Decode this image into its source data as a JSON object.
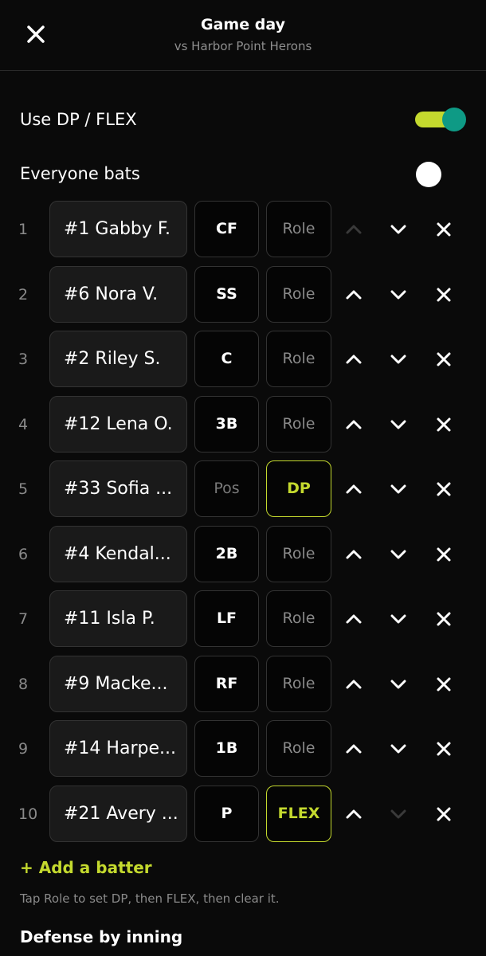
{
  "header": {
    "title": "Game day",
    "subtitle": "vs Harbor Point Herons",
    "close_icon": "close-icon"
  },
  "settings": {
    "dp_flex": {
      "label": "Use DP / FLEX",
      "enabled": true
    },
    "everyone_bats": {
      "label": "Everyone bats",
      "enabled": false
    }
  },
  "lineup": [
    {
      "order": "1",
      "player": "#1 Gabby F.",
      "position": "CF",
      "role": "Role",
      "up_enabled": false,
      "down_enabled": true
    },
    {
      "order": "2",
      "player": "#6 Nora V.",
      "position": "SS",
      "role": "Role",
      "up_enabled": true,
      "down_enabled": true
    },
    {
      "order": "3",
      "player": "#2 Riley S.",
      "position": "C",
      "role": "Role",
      "up_enabled": true,
      "down_enabled": true
    },
    {
      "order": "4",
      "player": "#12 Lena O.",
      "position": "3B",
      "role": "Role",
      "up_enabled": true,
      "down_enabled": true
    },
    {
      "order": "5",
      "player": "#33 Sofia ...",
      "position": "Pos",
      "role": "DP",
      "up_enabled": true,
      "down_enabled": true
    },
    {
      "order": "6",
      "player": "#4 Kendal...",
      "position": "2B",
      "role": "Role",
      "up_enabled": true,
      "down_enabled": true
    },
    {
      "order": "7",
      "player": "#11 Isla P.",
      "position": "LF",
      "role": "Role",
      "up_enabled": true,
      "down_enabled": true
    },
    {
      "order": "8",
      "player": "#9 Macke...",
      "position": "RF",
      "role": "Role",
      "up_enabled": true,
      "down_enabled": true
    },
    {
      "order": "9",
      "player": "#14 Harpe...",
      "position": "1B",
      "role": "Role",
      "up_enabled": true,
      "down_enabled": true
    },
    {
      "order": "10",
      "player": "#21 Avery ...",
      "position": "P",
      "role": "FLEX",
      "up_enabled": true,
      "down_enabled": false
    }
  ],
  "add_batter_label": "+ Add a batter",
  "hint": "Tap Role to set DP, then FLEX, then clear it.",
  "defense_title": "Defense by inning",
  "colors": {
    "accent": "#c4d92e",
    "toggle_knob": "#0e9a85",
    "background": "#0a0a0a"
  }
}
